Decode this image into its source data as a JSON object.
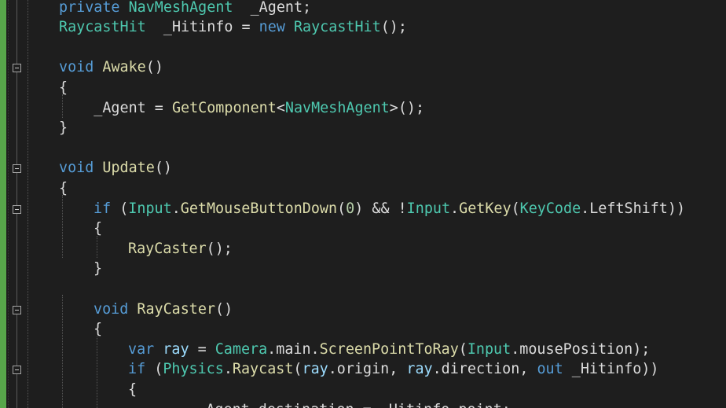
{
  "editor": {
    "language": "csharp",
    "colors": {
      "background": "#1e1e1e",
      "keyword": "#569cd6",
      "type": "#4ec9b0",
      "method": "#dcdcaa",
      "variable": "#9cdcfe",
      "number": "#b5cea8",
      "plain": "#dcdcdc",
      "change_bar": "#57a64a"
    },
    "lines": [
      {
        "col": 75,
        "tokens": [
          [
            "kw",
            "private"
          ],
          [
            "pl",
            " "
          ],
          [
            "ty",
            "NavMeshAgent"
          ],
          [
            "pl",
            "  _Agent;"
          ]
        ]
      },
      {
        "col": 75,
        "tokens": [
          [
            "ty",
            "RaycastHit"
          ],
          [
            "pl",
            "  _Hitinfo = "
          ],
          [
            "kw",
            "new"
          ],
          [
            "pl",
            " "
          ],
          [
            "ty",
            "RaycastHit"
          ],
          [
            "pl",
            "();"
          ]
        ]
      },
      {
        "col": 75,
        "tokens": []
      },
      {
        "col": 75,
        "fold": true,
        "tokens": [
          [
            "kw",
            "void"
          ],
          [
            "pl",
            " "
          ],
          [
            "fn",
            "Awake"
          ],
          [
            "pl",
            "()"
          ]
        ]
      },
      {
        "col": 75,
        "tokens": [
          [
            "pl",
            "{"
          ]
        ]
      },
      {
        "col": 75,
        "tokens": [
          [
            "pl",
            "    _Agent = "
          ],
          [
            "fn",
            "GetComponent"
          ],
          [
            "pl",
            "<"
          ],
          [
            "ty",
            "NavMeshAgent"
          ],
          [
            "pl",
            ">();"
          ]
        ]
      },
      {
        "col": 75,
        "tokens": [
          [
            "pl",
            "}"
          ]
        ]
      },
      {
        "col": 75,
        "tokens": []
      },
      {
        "col": 75,
        "fold": true,
        "tokens": [
          [
            "kw",
            "void"
          ],
          [
            "pl",
            " "
          ],
          [
            "fn",
            "Update"
          ],
          [
            "pl",
            "()"
          ]
        ]
      },
      {
        "col": 75,
        "tokens": [
          [
            "pl",
            "{"
          ]
        ]
      },
      {
        "col": 119,
        "fold": true,
        "tokens": [
          [
            "kw",
            "if"
          ],
          [
            "pl",
            " ("
          ],
          [
            "ty",
            "Input"
          ],
          [
            "pl",
            "."
          ],
          [
            "fn",
            "GetMouseButtonDown"
          ],
          [
            "pl",
            "("
          ],
          [
            "num",
            "0"
          ],
          [
            "pl",
            ") && !"
          ],
          [
            "ty",
            "Input"
          ],
          [
            "pl",
            "."
          ],
          [
            "fn",
            "GetKey"
          ],
          [
            "pl",
            "("
          ],
          [
            "ty",
            "KeyCode"
          ],
          [
            "pl",
            ".LeftShift))"
          ]
        ]
      },
      {
        "col": 119,
        "tokens": [
          [
            "pl",
            "{"
          ]
        ]
      },
      {
        "col": 163,
        "tokens": [
          [
            "fn",
            "RayCaster"
          ],
          [
            "pl",
            "();"
          ]
        ]
      },
      {
        "col": 119,
        "tokens": [
          [
            "pl",
            "}"
          ]
        ]
      },
      {
        "col": 119,
        "tokens": []
      },
      {
        "col": 119,
        "fold": true,
        "tokens": [
          [
            "kw",
            "void"
          ],
          [
            "pl",
            " "
          ],
          [
            "fn",
            "RayCaster"
          ],
          [
            "pl",
            "()"
          ]
        ]
      },
      {
        "col": 119,
        "tokens": [
          [
            "pl",
            "{"
          ]
        ]
      },
      {
        "col": 163,
        "tokens": [
          [
            "kw",
            "var"
          ],
          [
            "pl",
            " "
          ],
          [
            "var",
            "ray"
          ],
          [
            "pl",
            " = "
          ],
          [
            "ty",
            "Camera"
          ],
          [
            "pl",
            ".main."
          ],
          [
            "fn",
            "ScreenPointToRay"
          ],
          [
            "pl",
            "("
          ],
          [
            "ty",
            "Input"
          ],
          [
            "pl",
            ".mousePosition);"
          ]
        ]
      },
      {
        "col": 163,
        "fold": true,
        "tokens": [
          [
            "kw",
            "if"
          ],
          [
            "pl",
            " ("
          ],
          [
            "ty",
            "Physics"
          ],
          [
            "pl",
            "."
          ],
          [
            "fn",
            "Raycast"
          ],
          [
            "pl",
            "("
          ],
          [
            "var",
            "ray"
          ],
          [
            "pl",
            ".origin, "
          ],
          [
            "var",
            "ray"
          ],
          [
            "pl",
            ".direction, "
          ],
          [
            "kw",
            "out"
          ],
          [
            "pl",
            " _Hitinfo))"
          ]
        ]
      },
      {
        "col": 163,
        "tokens": [
          [
            "pl",
            "{"
          ]
        ]
      },
      {
        "col": 207,
        "tokens": [
          [
            "pl",
            "    _Agent.destination = _Hitinfo.point;"
          ]
        ]
      }
    ]
  }
}
